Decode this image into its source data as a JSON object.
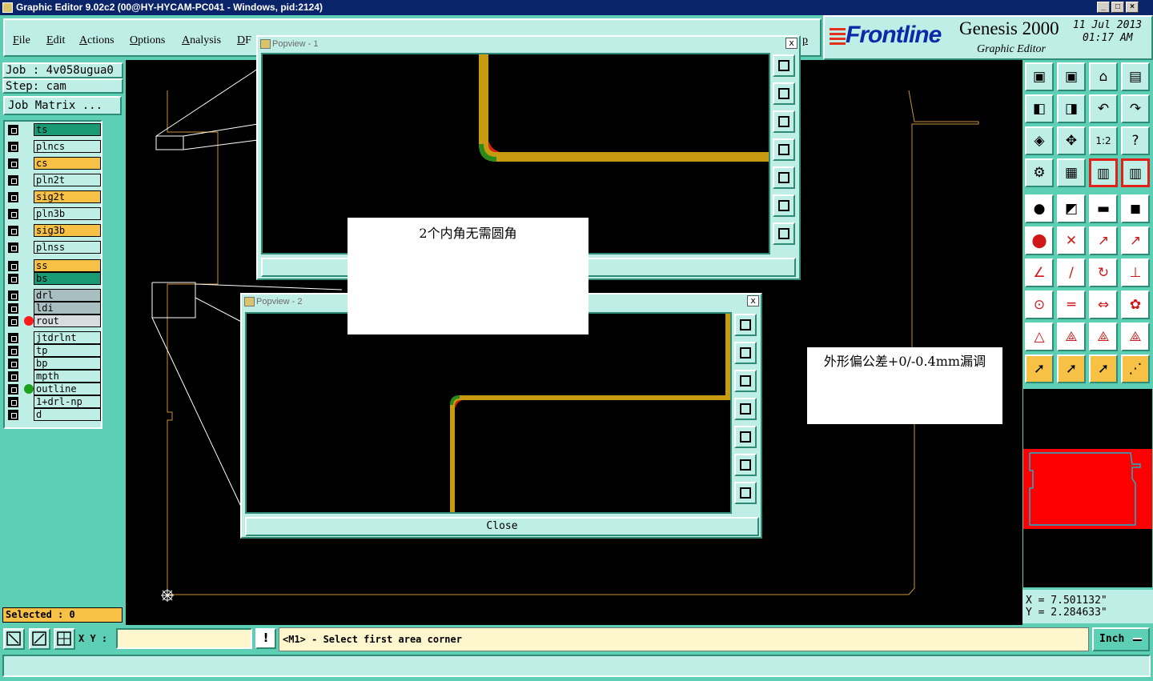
{
  "window": {
    "title": "Graphic Editor 9.02c2 (00@HY-HYCAM-PC041 - Windows, pid:2124)"
  },
  "menu": [
    {
      "label": "File"
    },
    {
      "label": "Edit"
    },
    {
      "label": "Actions"
    },
    {
      "label": "Options"
    },
    {
      "label": "Analysis"
    },
    {
      "label": "DF"
    },
    {
      "label": "p"
    }
  ],
  "brand": {
    "logo": "Frontline",
    "product": "Genesis 2000",
    "subtitle": "Graphic Editor",
    "date": "11 Jul 2013",
    "time": "01:17 AM"
  },
  "job": {
    "job_label": "Job : 4v058ugua0",
    "step_label": "Step: cam",
    "matrix_button": "Job Matrix ..."
  },
  "layers": [
    {
      "name": "ts",
      "color": "#1a9a74",
      "dot": ""
    },
    {
      "name": "plncs",
      "color": "#bfeee6",
      "dot": ""
    },
    {
      "name": "cs",
      "color": "#f7c146",
      "dot": ""
    },
    {
      "name": "pln2t",
      "color": "#bfeee6",
      "dot": ""
    },
    {
      "name": "sig2t",
      "color": "#f7c146",
      "dot": ""
    },
    {
      "name": "pln3b",
      "color": "#bfeee6",
      "dot": ""
    },
    {
      "name": "sig3b",
      "color": "#f7c146",
      "dot": ""
    },
    {
      "name": "plnss",
      "color": "#bfeee6",
      "dot": ""
    },
    {
      "name": "ss",
      "color": "#f7c146",
      "dot": ""
    },
    {
      "name": "bs",
      "color": "#1a9a74",
      "dot": ""
    },
    {
      "name": "drl",
      "color": "#a8bec0",
      "dot": ""
    },
    {
      "name": "ldi",
      "color": "#a8bec0",
      "dot": ""
    },
    {
      "name": "rout",
      "color": "#d8dcdc",
      "dot": "#ff1a1a"
    },
    {
      "name": "jtdrlnt",
      "color": "#bfeee6",
      "dot": ""
    },
    {
      "name": "tp",
      "color": "#bfeee6",
      "dot": ""
    },
    {
      "name": "bp",
      "color": "#bfeee6",
      "dot": ""
    },
    {
      "name": "mpth",
      "color": "#bfeee6",
      "dot": ""
    },
    {
      "name": "outline",
      "color": "#bfeee6",
      "dot": "#1aa01a"
    },
    {
      "name": "1+drl-np",
      "color": "#bfeee6",
      "dot": ""
    },
    {
      "name": "d",
      "color": "#bfeee6",
      "dot": ""
    }
  ],
  "selected": "Selected : 0",
  "popup1": {
    "title": "Popview - 1",
    "close": "x"
  },
  "popup2": {
    "title": "Popview - 2",
    "close": "x",
    "close_button": "Close"
  },
  "notes": {
    "note1": "2个内角无需圆角",
    "note2": "外形偏公差+0/-0.4mm漏调"
  },
  "coords": {
    "x": "X = 7.501132\"",
    "y": "Y = 2.284633\""
  },
  "bottom": {
    "xy_label": "X Y :",
    "xy_value": "",
    "warn": "!",
    "prompt": "<M1> - Select first area corner",
    "unit": "Inch"
  },
  "colors": {
    "copper": "#c79a12",
    "fill_green": "#2a8a1a",
    "fill_red": "#e02010",
    "outline": "#c8923c"
  }
}
